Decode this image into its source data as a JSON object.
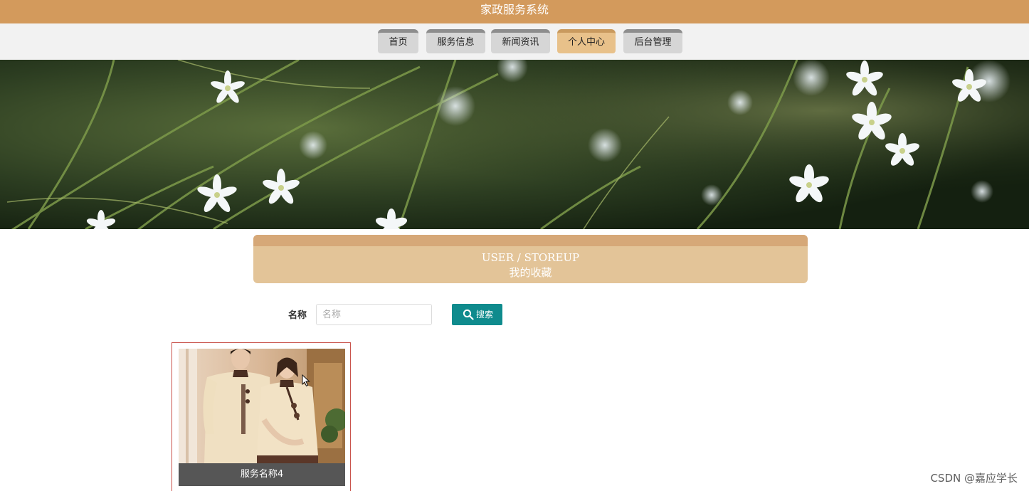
{
  "header": {
    "title": "家政服务系统"
  },
  "nav": {
    "items": [
      {
        "label": "首页",
        "active": false
      },
      {
        "label": "服务信息",
        "active": false
      },
      {
        "label": "新闻资讯",
        "active": false
      },
      {
        "label": "个人中心",
        "active": true
      },
      {
        "label": "后台管理",
        "active": false
      }
    ]
  },
  "section": {
    "title_en": "USER / STOREUP",
    "title_cn": "我的收藏"
  },
  "search": {
    "label": "名称",
    "placeholder": "名称",
    "value": "",
    "button_label": "搜索",
    "icon": "search-icon"
  },
  "favorites": [
    {
      "name": "服务名称4"
    }
  ],
  "watermark": "CSDN @嘉应学长",
  "colors": {
    "header": "#d39a5c",
    "nav_active": "#e8c18a",
    "section_bg": "#e3c498",
    "search_button": "#0f8b8d",
    "card_border": "#c9534b",
    "caption_bg": "#565656"
  }
}
